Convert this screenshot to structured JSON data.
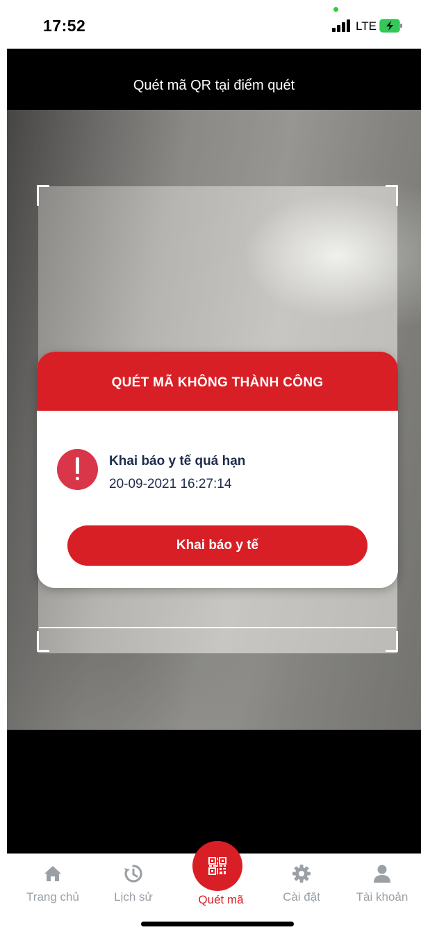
{
  "status_bar": {
    "time": "17:52",
    "network": "LTE"
  },
  "header": {
    "title": "Quét mã QR tại điểm quét"
  },
  "dialog": {
    "title": "QUÉT MÃ KHÔNG THÀNH CÔNG",
    "message_title": "Khai báo y tế quá hạn",
    "message_time": "20-09-2021 16:27:14",
    "button_label": "Khai báo y tế",
    "icon": "exclamation-icon"
  },
  "tabbar": {
    "items": [
      {
        "label": "Trang chủ",
        "icon": "home-icon",
        "active": false
      },
      {
        "label": "Lịch sử",
        "icon": "history-icon",
        "active": false
      },
      {
        "label": "Quét mã",
        "icon": "qr-code-icon",
        "active": true
      },
      {
        "label": "Cài đặt",
        "icon": "gear-icon",
        "active": false
      },
      {
        "label": "Tài khoản",
        "icon": "user-icon",
        "active": false
      }
    ]
  },
  "colors": {
    "accent": "#d91f26",
    "alert": "#d9364a",
    "text_dark": "#1e2b4d",
    "tab_inactive": "#9aa0a6"
  }
}
